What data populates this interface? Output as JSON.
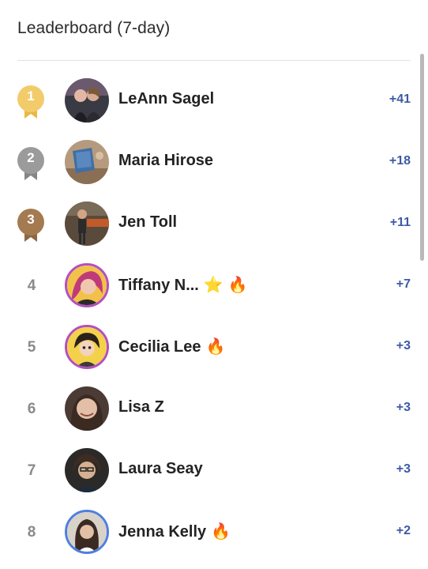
{
  "header": {
    "title": "Leaderboard (7-day)"
  },
  "colors": {
    "gold": "#f2cc6b",
    "silver": "#9b9b9b",
    "bronze": "#a47a50",
    "score": "#3c5aa6",
    "ring_purple": "#b34fbf",
    "ring_blue": "#4e7fe0"
  },
  "leaders": [
    {
      "rank": "1",
      "name": "LeAnn Sagel",
      "score": "+41",
      "medal": "gold-medal-icon"
    },
    {
      "rank": "2",
      "name": "Maria Hirose",
      "score": "+18",
      "medal": "silver-medal-icon"
    },
    {
      "rank": "3",
      "name": "Jen Toll",
      "score": "+11",
      "medal": "bronze-medal-icon"
    },
    {
      "rank": "4",
      "name": "Tiffany N...",
      "score": "+7",
      "badges": [
        "⭐",
        "🔥"
      ]
    },
    {
      "rank": "5",
      "name": "Cecilia Lee",
      "score": "+3",
      "badges": [
        "🔥"
      ]
    },
    {
      "rank": "6",
      "name": "Lisa Z",
      "score": "+3"
    },
    {
      "rank": "7",
      "name": "Laura Seay",
      "score": "+3"
    },
    {
      "rank": "8",
      "name": "Jenna Kelly",
      "score": "+2",
      "badges": [
        "🔥"
      ]
    }
  ]
}
